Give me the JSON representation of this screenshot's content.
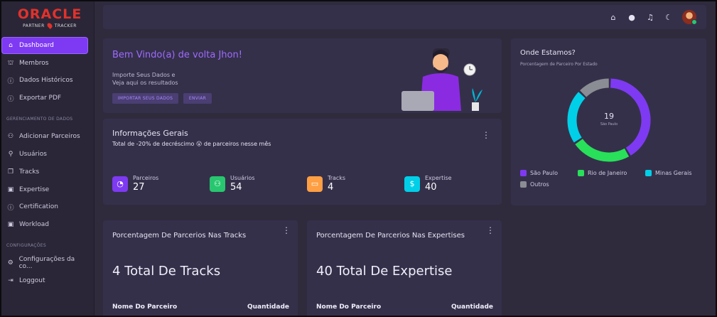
{
  "brand": {
    "name": "ORACLE",
    "left": "PARTNER",
    "right": "TRACKER"
  },
  "nav": {
    "main": [
      {
        "label": "Dashboard",
        "icon": "home-icon",
        "active": true
      },
      {
        "label": "Membros",
        "icon": "bank-icon"
      },
      {
        "label": "Dados Históricos",
        "icon": "info-icon"
      },
      {
        "label": "Exportar PDF",
        "icon": "info-icon"
      }
    ],
    "section1": "GERENCIAMENTO DE DADOS",
    "manage": [
      {
        "label": "Adicionar Parceiros",
        "icon": "users-add-icon"
      },
      {
        "label": "Usuários",
        "icon": "user-plus-icon"
      },
      {
        "label": "Tracks",
        "icon": "copy-icon"
      },
      {
        "label": "Expertise",
        "icon": "calendar-icon"
      },
      {
        "label": "Certification",
        "icon": "info-icon"
      },
      {
        "label": "Workload",
        "icon": "calendar-icon"
      }
    ],
    "section2": "CONFIGURAÇÕES",
    "settings": [
      {
        "label": "Configurações da co...",
        "icon": "settings-user-icon"
      },
      {
        "label": "Loggout",
        "icon": "logout-icon"
      }
    ]
  },
  "welcome": {
    "title": "Bem Vindo(a) de volta Jhon!",
    "line1": "Importe Seus Dados e",
    "line2": "Veja aqui os resultados",
    "btn1": "IMPORTAR SEUS DADOS",
    "btn2": "ENVIAR"
  },
  "info": {
    "title": "Informações Gerais",
    "subtitle": "Total de -20% de decréscimo 😮 de parceiros nesse mês",
    "stats": [
      {
        "label": "Parceiros",
        "value": "27",
        "color": "#7e3af2",
        "icon": "pie-icon"
      },
      {
        "label": "Usuários",
        "value": "54",
        "color": "#28c76f",
        "icon": "users-icon"
      },
      {
        "label": "Tracks",
        "value": "4",
        "color": "#ff9f43",
        "icon": "laptop-icon"
      },
      {
        "label": "Expertise",
        "value": "40",
        "color": "#00cfe8",
        "icon": "dollar-icon"
      }
    ]
  },
  "where": {
    "title": "Onde Estamos?",
    "subtitle": "Porcentagem de Parceiro Por Estado",
    "center_value": "19",
    "center_label": "São Paulo",
    "legend": [
      {
        "label": "São Paulo",
        "color": "#7e3af2"
      },
      {
        "label": "Rio de Janeiro",
        "color": "#28e05a"
      },
      {
        "label": "Minas Gerais",
        "color": "#00cfe8"
      },
      {
        "label": "Outros",
        "color": "#8a8d93"
      }
    ]
  },
  "chart_data": {
    "type": "pie",
    "categories": [
      "São Paulo",
      "Rio de Janeiro",
      "Minas Gerais",
      "Outros"
    ],
    "values": [
      19,
      11,
      10,
      6
    ],
    "colors": [
      "#7e3af2",
      "#28e05a",
      "#00cfe8",
      "#8a8d93"
    ]
  },
  "tracks_card": {
    "title": "Porcentagem De Parcerios Nas Tracks",
    "total": "4 Total De Tracks",
    "col1": "Nome Do Parceiro",
    "col2": "Quantidade"
  },
  "expertise_card": {
    "title": "Porcentagem De Parcerios Nas Expertises",
    "total": "40 Total De Expertise",
    "col1": "Nome Do Parceiro",
    "col2": "Quantidade"
  },
  "topbar": {
    "icons": [
      "home-icon",
      "github-icon",
      "bell-icon",
      "moon-icon"
    ]
  }
}
